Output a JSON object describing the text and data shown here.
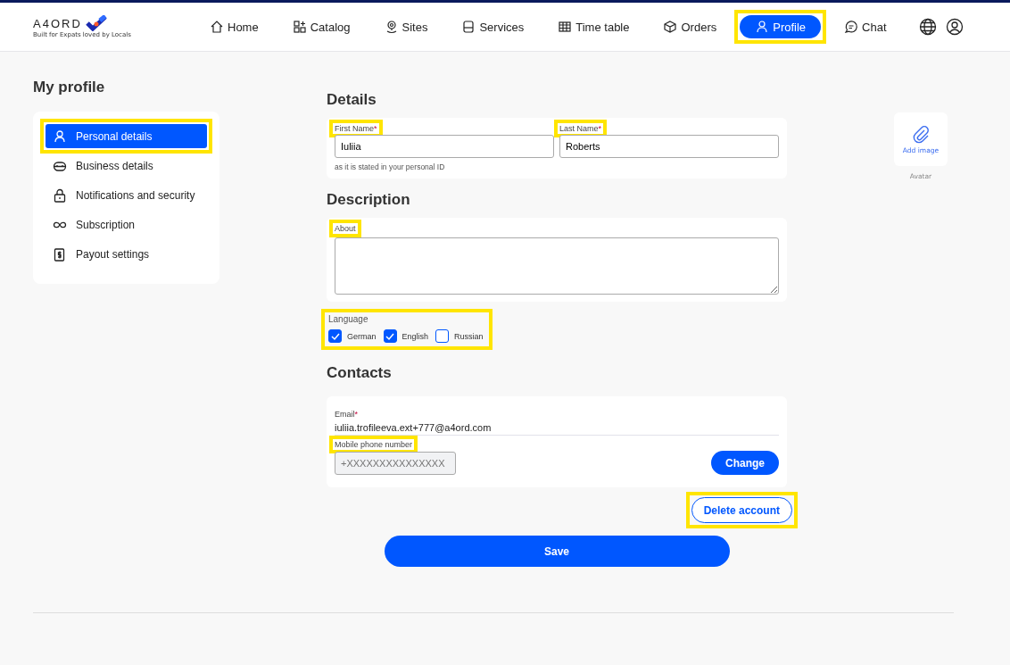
{
  "logo": {
    "name": "A4ORD",
    "tagline": "Built for Expats loved by Locals"
  },
  "nav": [
    {
      "label": "Home",
      "selected": false,
      "highlighted": false
    },
    {
      "label": "Catalog",
      "selected": false,
      "highlighted": false
    },
    {
      "label": "Sites",
      "selected": false,
      "highlighted": false
    },
    {
      "label": "Services",
      "selected": false,
      "highlighted": false
    },
    {
      "label": "Time table",
      "selected": false,
      "highlighted": false
    },
    {
      "label": "Orders",
      "selected": false,
      "highlighted": false
    },
    {
      "label": "Profile",
      "selected": true,
      "highlighted": true
    },
    {
      "label": "Chat",
      "selected": false,
      "highlighted": false
    }
  ],
  "sidebar": {
    "title": "My profile",
    "items": [
      {
        "label": "Personal details",
        "selected": true,
        "highlighted": true
      },
      {
        "label": "Business details",
        "selected": false,
        "highlighted": false
      },
      {
        "label": "Notifications and security",
        "selected": false,
        "highlighted": false
      },
      {
        "label": "Subscription",
        "selected": false,
        "highlighted": false
      },
      {
        "label": "Payout settings",
        "selected": false,
        "highlighted": false
      }
    ]
  },
  "details": {
    "title": "Details",
    "fields": [
      {
        "label": "First Name",
        "required_mark": "*",
        "value": "Iuliia",
        "highlighted": true
      },
      {
        "label": "Last Name",
        "required_mark": "*",
        "value": "Roberts",
        "highlighted": true
      }
    ],
    "hint": "as it is stated in your personal ID"
  },
  "description": {
    "title": "Description",
    "about": {
      "label": "About",
      "highlighted": true
    }
  },
  "language": {
    "label": "Language",
    "highlighted": true,
    "options": [
      {
        "label": "German",
        "checked": true
      },
      {
        "label": "English",
        "checked": true
      },
      {
        "label": "Russian",
        "checked": false
      }
    ]
  },
  "contacts": {
    "title": "Contacts",
    "email": {
      "label": "Email",
      "required_mark": "*",
      "value": "iuliia.trofileeva.ext+777@a4ord.com"
    },
    "phone": {
      "label": "Mobile phone number",
      "highlighted": true,
      "placeholder": "+XXXXXXXXXXXXXXX",
      "disabled": true
    },
    "change_button": "Change"
  },
  "delete_button": {
    "label": "Delete account",
    "highlighted": true
  },
  "save_button": "Save",
  "avatar": {
    "button": "Add image",
    "caption": "Avatar"
  }
}
